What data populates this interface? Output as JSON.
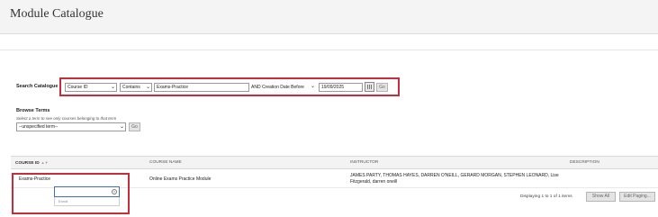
{
  "header": {
    "title": "Module Catalogue"
  },
  "search": {
    "label": "Search Catalogue",
    "field": "Course ID",
    "operator": "Contains",
    "term": "Exams-Practice",
    "date_label": "AND Creation Date Before",
    "date": "19/09/2025",
    "go": "Go"
  },
  "browse": {
    "title": "Browse Terms",
    "description": "Select a term to see only courses belonging to that term",
    "term_select": "--unspecified term--",
    "go": "Go"
  },
  "table": {
    "headers": [
      "COURSE ID",
      "COURSE NAME",
      "INSTRUCTOR",
      "DESCRIPTION"
    ],
    "rows": [
      {
        "course_id": "Exams-Practice",
        "course_name": "Online Exams Practice Module",
        "instructor_line1": "JAMES PARTY, THOMAS HAYES, DARREN O'NEILL, GERARD MORGAN, STEPHEN LEONARD, Lise",
        "instructor_line2": "Fitzgerald, darren oneill"
      }
    ],
    "edit_popup": {
      "value": "",
      "hint": "Enroll"
    }
  },
  "paging": {
    "status": "Displaying 1 to 1 of 1 items",
    "show_all": "Show All",
    "edit_paging": "Edit Paging..."
  },
  "colors": {
    "highlight": "#c62d3a",
    "header_bg": "#f4f4f4"
  },
  "icons": {
    "calendar": "calendar-icon",
    "sort": "sort-icon",
    "clear": "clear-icon"
  }
}
